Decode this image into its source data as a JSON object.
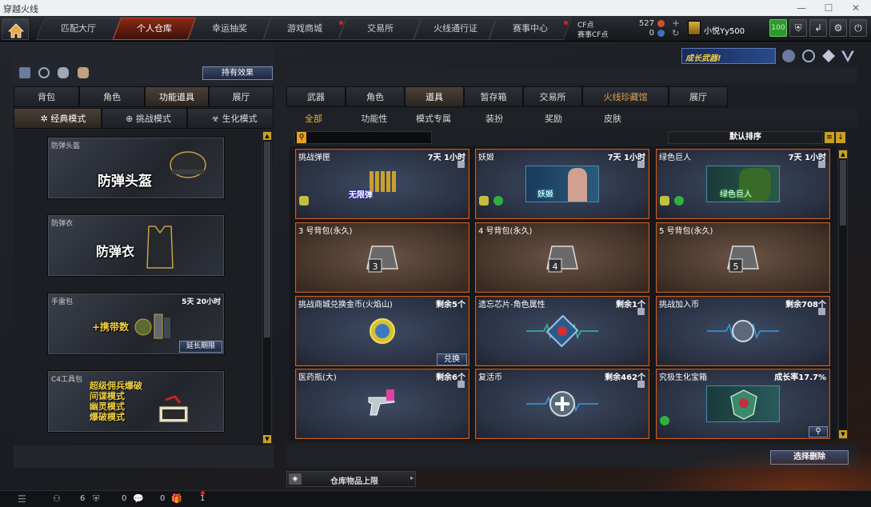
{
  "window": {
    "title": "穿越火线"
  },
  "nav": {
    "tabs": [
      "匹配大厅",
      "个人仓库",
      "幸运抽奖",
      "游戏商城",
      "交易所",
      "火线通行证",
      "赛事中心"
    ],
    "cf_label": "CF点",
    "cf_value": "527",
    "event_cf_label": "赛事CF点",
    "event_cf_value": "0",
    "username": "小悦Yy500",
    "level": "100"
  },
  "left": {
    "hold_effect_label": "持有效果",
    "tabs": [
      "背包",
      "角色",
      "功能道具",
      "展厅"
    ],
    "modes": [
      "经典模式",
      "挑战模式",
      "生化模式"
    ],
    "items": [
      {
        "label": "防弹头盔",
        "big": "防弹头盔"
      },
      {
        "label": "防弹衣",
        "big": "防弹衣"
      },
      {
        "label": "手雷包",
        "big": "+携带数",
        "time": "5天 20小时",
        "action": "延长期限"
      },
      {
        "label": "C4工具包",
        "lines": [
          "超级佣兵爆破",
          "间谍模式",
          "幽灵模式",
          "爆破模式"
        ]
      }
    ]
  },
  "right": {
    "banner_text": "成长武器!",
    "tabs": [
      "武器",
      "角色",
      "道具",
      "暂存箱",
      "交易所",
      "火线珍藏馆",
      "展厅"
    ],
    "subtabs": [
      "全部",
      "功能性",
      "模式专属",
      "装扮",
      "奖励",
      "皮肤"
    ],
    "search_placeholder": "",
    "sort_label": "默认排序",
    "items": [
      {
        "name": "挑战弹匣",
        "time": "7天 1小时",
        "thumb": "无限弹"
      },
      {
        "name": "妖姬",
        "time": "7天 1小时",
        "thumb": "妖姬"
      },
      {
        "name": "绿色巨人",
        "time": "7天 1小时",
        "thumb": "绿色巨人"
      },
      {
        "name": "3 号背包(永久)",
        "time": "",
        "thumb": "3"
      },
      {
        "name": "4 号背包(永久)",
        "time": "",
        "thumb": "4"
      },
      {
        "name": "5 号背包(永久)",
        "time": "",
        "thumb": "5"
      },
      {
        "name": "挑战商城兑换金币(火焰山)",
        "time": "剩余5个",
        "action": "兑换"
      },
      {
        "name": "遗忘芯片-角色属性",
        "time": "剩余1个"
      },
      {
        "name": "挑战加入币",
        "time": "剩余708个"
      },
      {
        "name": "医药瓶(大)",
        "time": "剩余6个"
      },
      {
        "name": "复活币",
        "time": "剩余462个"
      },
      {
        "name": "究极生化宝箱",
        "time": "成长率17.7%"
      }
    ],
    "select_delete_label": "选择删除",
    "warehouse_upload_label": "仓库物品上限"
  },
  "status": {
    "count_a": "6",
    "count_b": "0",
    "count_c": "0",
    "count_d": "1"
  },
  "colors": {
    "accent": "#c0602a",
    "gold": "#c8a020",
    "active_tab": "#8a2a18"
  }
}
